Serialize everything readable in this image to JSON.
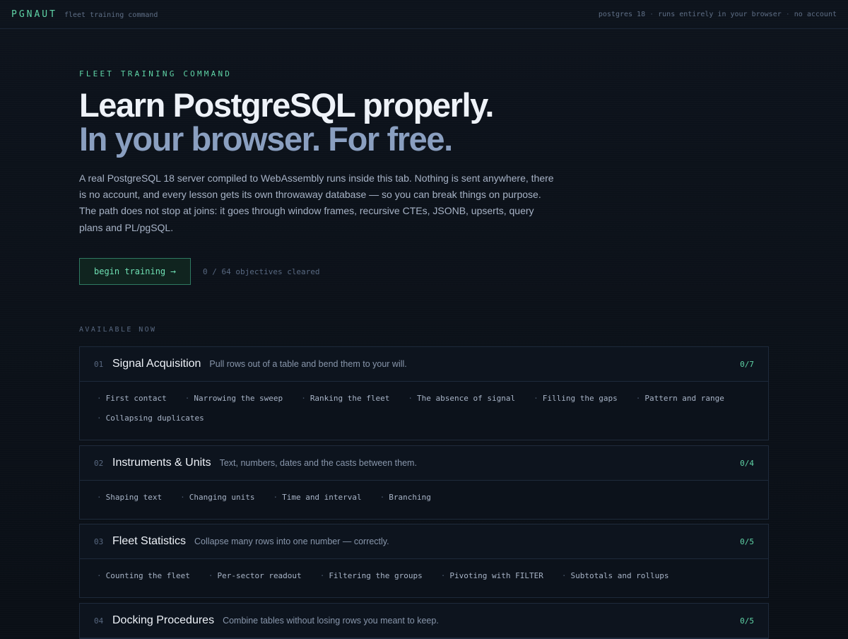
{
  "topbar": {
    "brand": "PGNAUT",
    "subtitle": "fleet training command",
    "meta": [
      "postgres 18",
      "runs entirely in your browser",
      "no account"
    ],
    "separator": "·"
  },
  "hero": {
    "eyebrow": "FLEET TRAINING COMMAND",
    "title_line1": "Learn PostgreSQL properly.",
    "title_line2": "In your browser. For free.",
    "description": "A real PostgreSQL 18 server compiled to WebAssembly runs inside this tab. Nothing is sent anywhere, there is no account, and every lesson gets its own throwaway database — so you can break things on purpose. The path does not stop at joins: it goes through window frames, recursive CTEs, JSONB, upserts, query plans and PL/pgSQL.",
    "cta_label": "begin training",
    "cta_icon": "arrow-right-icon",
    "progress": "0 / 64 objectives cleared"
  },
  "section_label": "AVAILABLE NOW",
  "lesson_bullet": "·",
  "modules": [
    {
      "num": "01",
      "title": "Signal Acquisition",
      "desc": "Pull rows out of a table and bend them to your will.",
      "count": "0/7",
      "lessons": [
        "First contact",
        "Narrowing the sweep",
        "Ranking the fleet",
        "The absence of signal",
        "Filling the gaps",
        "Pattern and range",
        "Collapsing duplicates"
      ]
    },
    {
      "num": "02",
      "title": "Instruments & Units",
      "desc": "Text, numbers, dates and the casts between them.",
      "count": "0/4",
      "lessons": [
        "Shaping text",
        "Changing units",
        "Time and interval",
        "Branching"
      ]
    },
    {
      "num": "03",
      "title": "Fleet Statistics",
      "desc": "Collapse many rows into one number — correctly.",
      "count": "0/5",
      "lessons": [
        "Counting the fleet",
        "Per-sector readout",
        "Filtering the groups",
        "Pivoting with FILTER",
        "Subtotals and rollups"
      ]
    },
    {
      "num": "04",
      "title": "Docking Procedures",
      "desc": "Combine tables without losing rows you meant to keep.",
      "count": "0/5",
      "lessons": []
    }
  ],
  "colors": {
    "accent": "#5fd3a6",
    "background": "#0b1018",
    "title": "#eef2f8",
    "subtitle": "#8a9fc0"
  }
}
